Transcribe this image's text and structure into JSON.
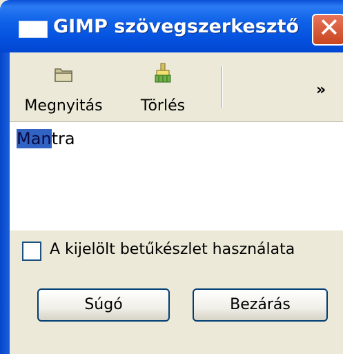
{
  "window": {
    "title": "GIMP szövegszerkesztő",
    "close_glyph": "✕"
  },
  "toolbar": {
    "open_label": "Megnyitás",
    "clear_label": "Törlés",
    "overflow_glyph": "»"
  },
  "editor": {
    "selected_text": "Man",
    "rest_text": "tra"
  },
  "options": {
    "use_selected_font_label": "A kijelölt betűkészlet használata",
    "use_selected_font_checked": false
  },
  "buttons": {
    "help_label": "Súgó",
    "close_label": "Bezárás"
  },
  "colors": {
    "titlebar": "#0553e0",
    "selection": "#3163c5",
    "close_button": "#c9461f"
  }
}
